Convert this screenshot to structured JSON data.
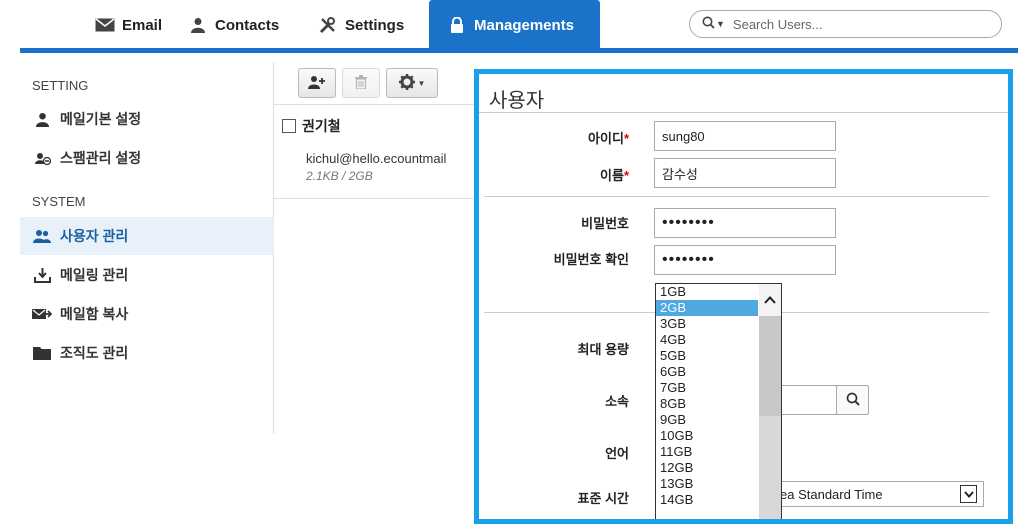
{
  "nav": {
    "tabs": [
      {
        "label": "Email",
        "icon": "envelope-icon"
      },
      {
        "label": "Contacts",
        "icon": "person-icon"
      },
      {
        "label": "Settings",
        "icon": "wrench-icon"
      },
      {
        "label": "Managements",
        "icon": "lock-icon",
        "active": true
      }
    ],
    "search_placeholder": "Search Users..."
  },
  "sidebar": {
    "setting_header": "SETTING",
    "system_header": "SYSTEM",
    "items": [
      {
        "label": "메일기본 설정",
        "icon": "person-icon"
      },
      {
        "label": "스팸관리 설정",
        "icon": "spam-filter-icon"
      },
      {
        "label": "사용자 관리",
        "icon": "users-icon",
        "active": true
      },
      {
        "label": "메일링 관리",
        "icon": "mailing-icon"
      },
      {
        "label": "메일함 복사",
        "icon": "mail-copy-icon"
      },
      {
        "label": "조직도 관리",
        "icon": "folder-icon"
      }
    ]
  },
  "list": {
    "rows": [
      {
        "name": "권기철",
        "email": "kichul@hello.ecountmail",
        "size": "2.1KB / 2GB"
      }
    ]
  },
  "dialog": {
    "title": "사용자",
    "id_label": "아이디",
    "id_value": "sung80",
    "name_label": "이름",
    "name_value": "감수성",
    "required_mark": "*",
    "password_label": "비밀번호",
    "password_value": "••••••••",
    "password_confirm_label": "비밀번호 확인",
    "password_confirm_value": "••••••••",
    "quota_label": "최대 용량",
    "department_label": "소속",
    "language_label": "언어",
    "timezone_label": "표준 시간",
    "timezone_value": "ea Standard Time",
    "quota_options": [
      "1GB",
      "2GB",
      "3GB",
      "4GB",
      "5GB",
      "6GB",
      "7GB",
      "8GB",
      "9GB",
      "10GB",
      "11GB",
      "12GB",
      "13GB",
      "14GB"
    ],
    "quota_selected": "2GB"
  },
  "colors": {
    "accent": "#1a73c9",
    "dialog_border": "#1aa0e6",
    "selection": "#50a8e0",
    "required": "#dd0000"
  }
}
